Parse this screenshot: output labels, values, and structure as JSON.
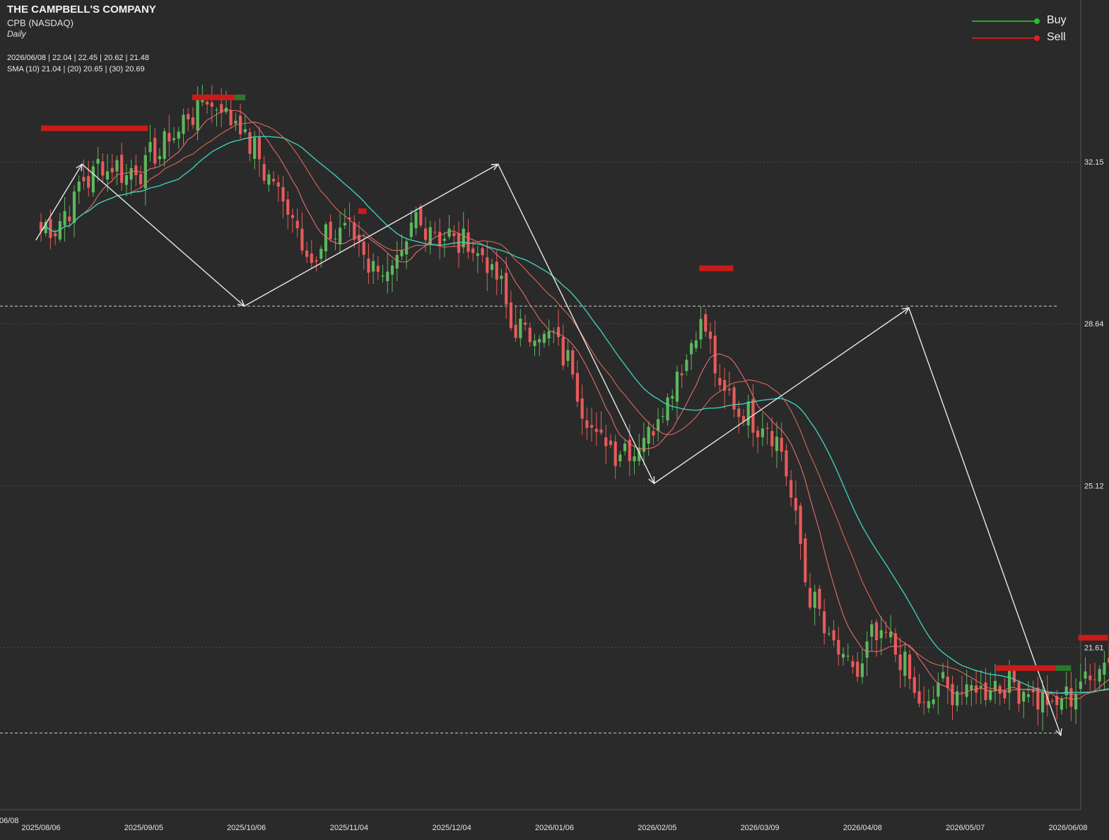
{
  "header": {
    "title": "THE CAMPBELL'S COMPANY",
    "symbol": "CPB (NASDAQ)",
    "interval": "Daily",
    "ohlc": "2026/06/08 | 22.04 | 22.45 | 20.62 | 21.48",
    "sma": "SMA (10) 21.04 | (20) 20.65 | (30) 20.69"
  },
  "legend": [
    {
      "label": "Buy",
      "color": "#22c02a"
    },
    {
      "label": "Sell",
      "color": "#e02020"
    }
  ],
  "colors": {
    "background": "#2a2a2a",
    "up_candle": "#5cb85c",
    "down_candle": "#e85a5a",
    "sma10": "#f07070",
    "sma20": "#e46a5a",
    "sma30": "#3dd6c0",
    "zigzag": "#e8e8e8",
    "signal_bar": "#cc1a1a"
  },
  "chart_data": {
    "type": "candlestick",
    "x_tick_labels": [
      "2025/08/06",
      "2025/09/05",
      "2025/10/06",
      "2025/11/04",
      "2025/12/04",
      "2026/01/06",
      "2026/02/05",
      "2026/03/09",
      "2026/04/08",
      "2026/05/07",
      "2026/06/08"
    ],
    "left_edge_label": "06/08",
    "y_tick_labels": [
      32.15,
      28.64,
      25.12,
      21.61
    ],
    "ylim": [
      19.0,
      34.0
    ],
    "grid": "horizontal dotted at y ticks",
    "legend_position": "top-right",
    "anchors": [
      {
        "x": 0.0,
        "y": 30.65
      },
      {
        "x": 0.2,
        "y": 30.85
      },
      {
        "x": 0.4,
        "y": 31.7
      },
      {
        "x": 0.6,
        "y": 32.1
      },
      {
        "x": 0.85,
        "y": 31.9
      },
      {
        "x": 1.0,
        "y": 32.05
      },
      {
        "x": 1.35,
        "y": 32.9
      },
      {
        "x": 1.6,
        "y": 33.55
      },
      {
        "x": 1.9,
        "y": 33.05
      },
      {
        "x": 2.2,
        "y": 31.9
      },
      {
        "x": 2.5,
        "y": 30.8
      },
      {
        "x": 2.65,
        "y": 29.85
      },
      {
        "x": 2.8,
        "y": 30.55
      },
      {
        "x": 3.0,
        "y": 30.8
      },
      {
        "x": 3.2,
        "y": 29.95
      },
      {
        "x": 3.45,
        "y": 29.65
      },
      {
        "x": 3.65,
        "y": 30.9
      },
      {
        "x": 4.0,
        "y": 30.45
      },
      {
        "x": 4.2,
        "y": 30.35
      },
      {
        "x": 4.45,
        "y": 29.6
      },
      {
        "x": 4.6,
        "y": 28.5
      },
      {
        "x": 4.95,
        "y": 28.4
      },
      {
        "x": 5.15,
        "y": 27.8
      },
      {
        "x": 5.35,
        "y": 26.3
      },
      {
        "x": 5.6,
        "y": 25.9
      },
      {
        "x": 5.8,
        "y": 25.95
      },
      {
        "x": 6.0,
        "y": 26.6
      },
      {
        "x": 6.25,
        "y": 27.8
      },
      {
        "x": 6.45,
        "y": 28.8
      },
      {
        "x": 6.6,
        "y": 27.2
      },
      {
        "x": 6.9,
        "y": 26.6
      },
      {
        "x": 7.15,
        "y": 26.3
      },
      {
        "x": 7.3,
        "y": 25.0
      },
      {
        "x": 7.45,
        "y": 23.0
      },
      {
        "x": 7.7,
        "y": 21.6
      },
      {
        "x": 7.95,
        "y": 21.0
      },
      {
        "x": 8.1,
        "y": 21.85
      },
      {
        "x": 8.3,
        "y": 21.7
      },
      {
        "x": 8.45,
        "y": 20.95
      },
      {
        "x": 8.6,
        "y": 20.15
      },
      {
        "x": 8.75,
        "y": 20.85
      },
      {
        "x": 8.9,
        "y": 20.6
      },
      {
        "x": 9.2,
        "y": 20.75
      },
      {
        "x": 9.45,
        "y": 20.85
      },
      {
        "x": 9.65,
        "y": 20.6
      },
      {
        "x": 9.85,
        "y": 20.3
      },
      {
        "x": 10.05,
        "y": 20.65
      },
      {
        "x": 10.25,
        "y": 21.05
      },
      {
        "x": 10.4,
        "y": 21.5
      }
    ],
    "sma_periods": [
      10,
      20,
      30
    ],
    "zigzag": [
      {
        "x": -0.05,
        "y": 30.45
      },
      {
        "x": 0.4,
        "y": 32.1
      },
      {
        "x": 1.98,
        "y": 29.02
      },
      {
        "x": 4.45,
        "y": 32.1
      },
      {
        "x": 5.97,
        "y": 25.17
      },
      {
        "x": 8.45,
        "y": 28.98
      },
      {
        "x": 9.93,
        "y": 19.7
      }
    ],
    "dashed_levels": [
      {
        "y": 29.02,
        "x_end": 9.9
      },
      {
        "y": 19.75,
        "x_end": 9.9
      }
    ],
    "signal_bars": [
      {
        "x0": 0.0,
        "x1": 1.04,
        "y": 32.88,
        "type": "sell"
      },
      {
        "x0": 1.47,
        "x1": 1.99,
        "y": 33.55,
        "type": "mixed"
      },
      {
        "x0": 3.09,
        "x1": 3.17,
        "y": 31.08,
        "type": "sell"
      },
      {
        "x0": 6.41,
        "x1": 6.74,
        "y": 29.84,
        "type": "sell"
      },
      {
        "x0": 9.3,
        "x1": 10.03,
        "y": 21.16,
        "type": "mixed"
      },
      {
        "x0": 10.1,
        "x1": 10.39,
        "y": 21.82,
        "type": "sell"
      }
    ]
  }
}
